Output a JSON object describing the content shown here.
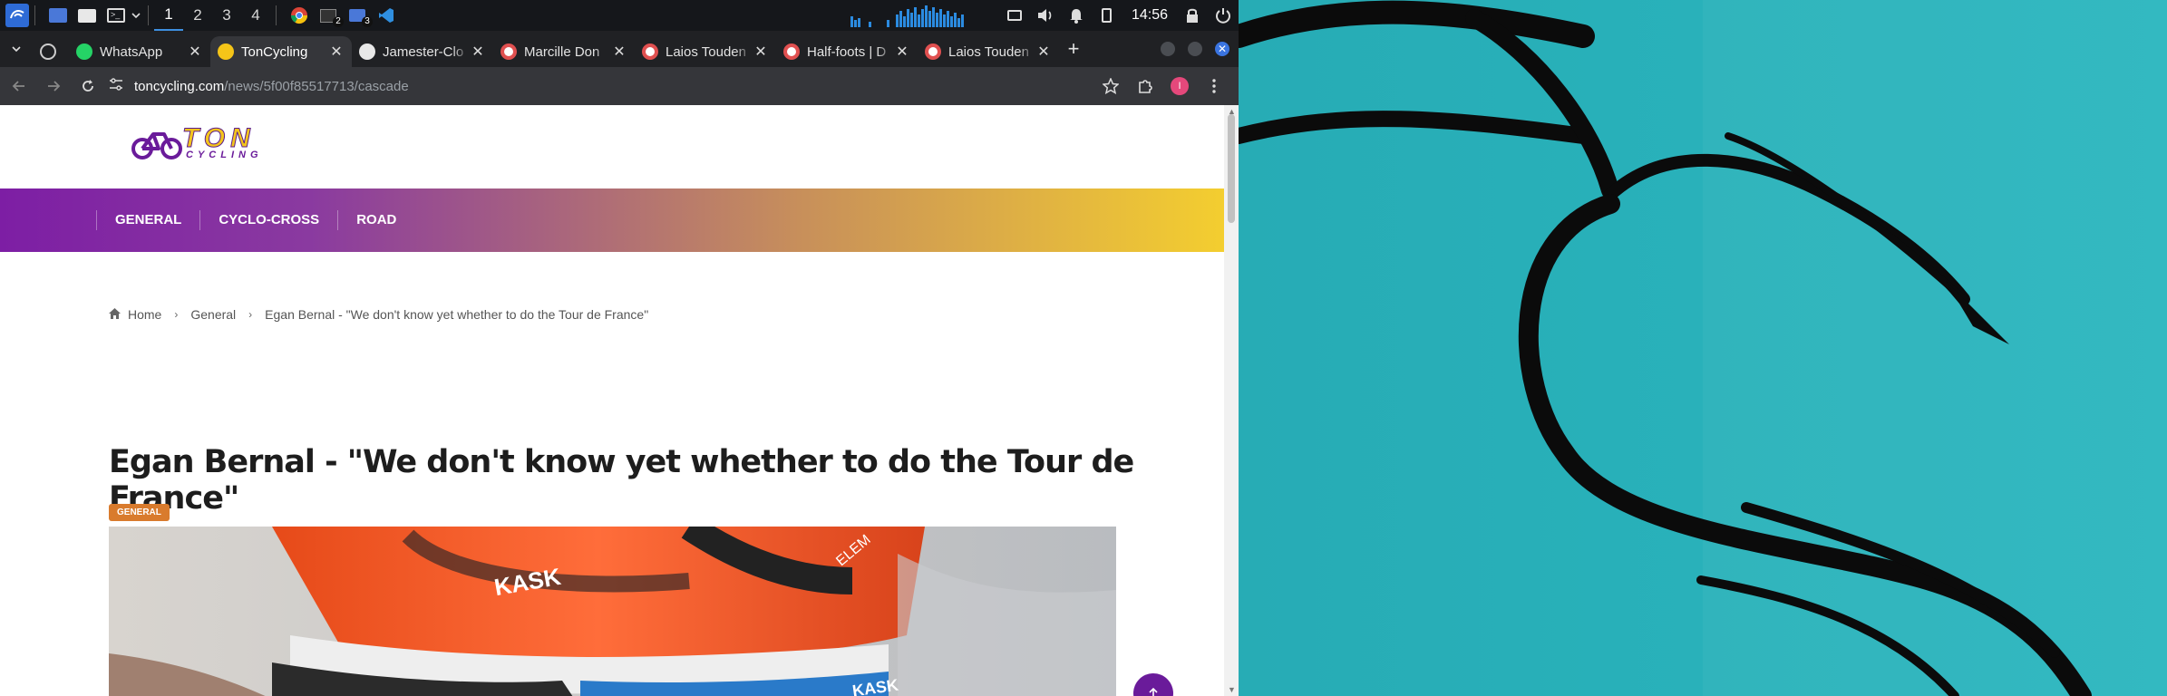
{
  "taskbar": {
    "workspaces": [
      "1",
      "2",
      "3",
      "4"
    ],
    "active_workspace": "1",
    "app_badges": [
      "2",
      "3"
    ],
    "clock": "14:56"
  },
  "browser": {
    "tabs": [
      {
        "title": "WhatsApp",
        "icon": "whatsapp-icon",
        "active": false
      },
      {
        "title": "TonCycling",
        "icon": "toncycling-icon",
        "active": true
      },
      {
        "title": "Jamester-Clo",
        "icon": "github-icon",
        "active": false
      },
      {
        "title": "Marcille Don",
        "icon": "site-icon",
        "active": false
      },
      {
        "title": "Laios Touden",
        "icon": "site-icon",
        "active": false
      },
      {
        "title": "Half-foots | D",
        "icon": "site-icon",
        "active": false
      },
      {
        "title": "Laios Touden",
        "icon": "site-icon",
        "active": false
      }
    ],
    "url_host": "toncycling.com",
    "url_path": "/news/5f00f85517713/cascade",
    "profile_initial": "I"
  },
  "site": {
    "logo_word": "TON",
    "logo_sub": "CYCLING",
    "nav": [
      "GENERAL",
      "CYCLO-CROSS",
      "ROAD"
    ],
    "breadcrumb": {
      "home": "Home",
      "section": "General",
      "current": "Egan Bernal - \"We don't know yet whether to do the Tour de France\""
    },
    "article_title": "Egan Bernal - \"We don't know yet whether to do the Tour de France\"",
    "category": "GENERAL",
    "hero_texts": [
      "KASK",
      "ELEM",
      "KASK"
    ]
  },
  "colors": {
    "nav_start": "#7d1ea4",
    "nav_end": "#f5d02e",
    "badge": "#d97b2d",
    "back_to_top": "#6a1b9a",
    "desktop": "#25a7b1"
  }
}
